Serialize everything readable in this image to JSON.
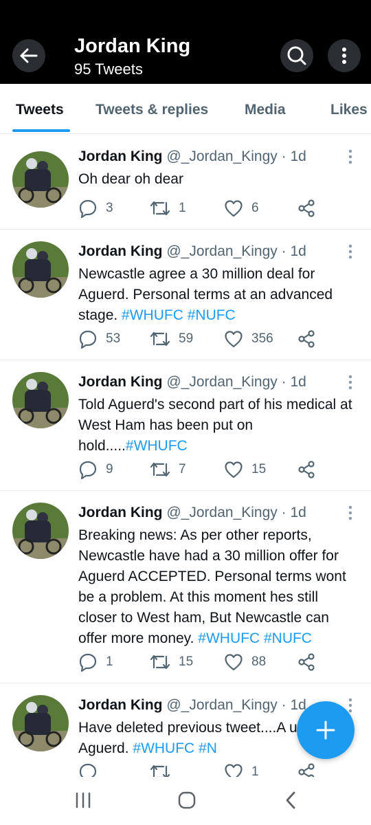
{
  "header": {
    "title": "Jordan King",
    "subtitle": "95 Tweets",
    "back_icon": "arrow-left-icon",
    "search_icon": "search-icon",
    "more_icon": "more-vertical-icon"
  },
  "tabs": [
    {
      "label": "Tweets",
      "active": true
    },
    {
      "label": "Tweets & replies",
      "active": false
    },
    {
      "label": "Media",
      "active": false
    },
    {
      "label": "Likes",
      "active": false
    }
  ],
  "tweets": [
    {
      "name": "Jordan King",
      "handle": "@_Jordan_Kingy",
      "dot": "·",
      "time": "1d",
      "text_parts": [
        "Oh dear oh dear"
      ],
      "hashtags": [],
      "replies": "3",
      "retweets": "1",
      "likes": "6"
    },
    {
      "name": "Jordan King",
      "handle": "@_Jordan_Kingy",
      "dot": "·",
      "time": "1d",
      "text_parts": [
        "Newcastle agree a 30 million deal for Aguerd. Personal terms at an advanced stage. "
      ],
      "hashtags": [
        "#WHUFC",
        "#NUFC"
      ],
      "replies": "53",
      "retweets": "59",
      "likes": "356"
    },
    {
      "name": "Jordan King",
      "handle": "@_Jordan_Kingy",
      "dot": "·",
      "time": "1d",
      "text_parts": [
        "Told Aguerd's second part of his medical at West Ham has been put on hold....."
      ],
      "hashtags": [
        "#WHUFC"
      ],
      "replies": "9",
      "retweets": "7",
      "likes": "15"
    },
    {
      "name": "Jordan King",
      "handle": "@_Jordan_Kingy",
      "dot": "·",
      "time": "1d",
      "text_parts": [
        "Breaking news: As per other reports, Newcastle have had a 30 million offer for Aguerd ACCEPTED. Personal terms wont be a problem. At this moment hes still closer to West ham, But Newcastle can offer more money. "
      ],
      "hashtags": [
        "#WHUFC",
        "#NUFC"
      ],
      "replies": "1",
      "retweets": "15",
      "likes": "88"
    },
    {
      "name": "Jordan King",
      "handle": "@_Jordan_Kingy",
      "dot": "·",
      "time": "1d",
      "text_parts": [
        "Have deleted previous tweet....A update on Aguerd. "
      ],
      "hashtags": [
        "#WHUFC",
        "#N"
      ],
      "replies": "",
      "retweets": "",
      "likes": "1"
    }
  ],
  "fab": {
    "icon": "plus-icon"
  },
  "colors": {
    "accent": "#1d9bf0",
    "header_bg": "#000000",
    "muted": "#536471"
  }
}
